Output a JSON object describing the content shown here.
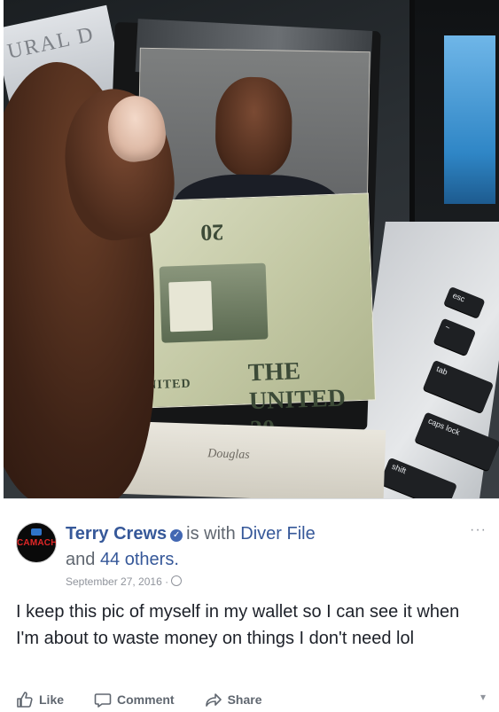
{
  "photo": {
    "newspaper_text": "URAL D",
    "bill_top_text": "20",
    "bill_bottom_text": "THE UNITED 20",
    "bill_side_text": "NITED",
    "signature": "Douglas",
    "keys": {
      "esc": "esc",
      "tilde": "~",
      "tab": "tab",
      "caps_lock": "caps lock",
      "shift": "shift"
    }
  },
  "post": {
    "avatar_text": "CAMACHO",
    "author": "Terry Crews",
    "with_text": "is with",
    "with_name": "Diver File",
    "and_text": "and",
    "others": "44 others.",
    "date": "September 27, 2016 ·",
    "more_label": "···",
    "body": "I keep this pic of myself in my wallet so I can see it when I'm about to waste money on things I don't need lol",
    "actions": {
      "like": "Like",
      "comment": "Comment",
      "share": "Share"
    },
    "dropdown_glyph": "▾"
  }
}
